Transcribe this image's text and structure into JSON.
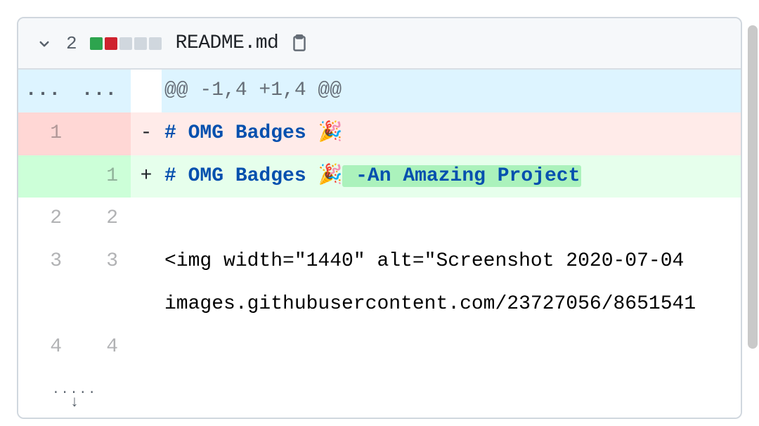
{
  "file": {
    "filename": "README.md",
    "change_count": "2",
    "diffstat": [
      "add",
      "del",
      "neutral",
      "neutral",
      "neutral"
    ]
  },
  "hunk": {
    "header": "@@ -1,4 +1,4 @@",
    "ellipsis": "..."
  },
  "rows": [
    {
      "kind": "del",
      "old": "1",
      "new": "",
      "marker": "-",
      "heading_prefix": "# OMG Badges ",
      "emoji": "🎉",
      "added_text": ""
    },
    {
      "kind": "add",
      "old": "",
      "new": "1",
      "marker": "+",
      "heading_prefix": "# OMG Badges ",
      "emoji": "🎉",
      "added_text": " -An Amazing Project"
    },
    {
      "kind": "ctx",
      "old": "2",
      "new": "2",
      "marker": "",
      "text": ""
    },
    {
      "kind": "ctx",
      "old": "3",
      "new": "3",
      "marker": "",
      "text": "<img width=\"1440\" alt=\"Screenshot 2020-07-04"
    },
    {
      "kind": "ctxwrap",
      "old": "",
      "new": "",
      "marker": "",
      "text": "images.githubusercontent.com/23727056/8651541"
    },
    {
      "kind": "ctx",
      "old": "4",
      "new": "4",
      "marker": "",
      "text": ""
    }
  ]
}
